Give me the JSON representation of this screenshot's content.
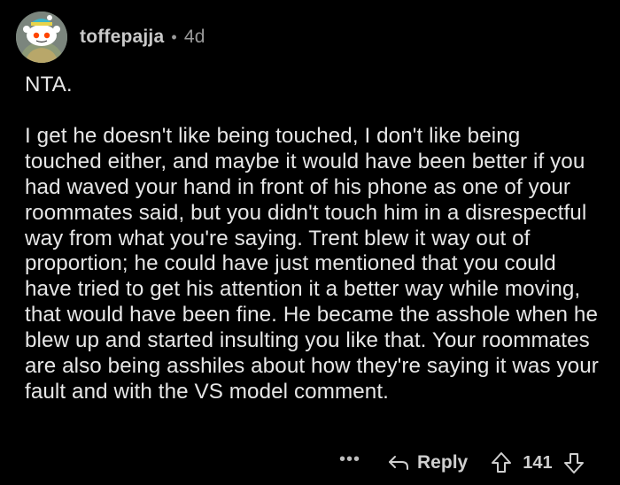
{
  "comment": {
    "author": "toffepajja",
    "separator": "•",
    "age": "4d",
    "paragraphs": [
      "NTA.",
      "I get he doesn't like being touched, I don't like being touched either, and maybe it would have been better if you had waved your hand in front of his phone as one of your roommates said, but you didn't touch him in a disrespectful way from what you're saying. Trent blew it way out of proportion; he could have just mentioned that you could have tried to get his attention it a better way while moving, that would have been fine. He became the asshole when he blew up and started insulting you like that. Your roommates are also being asshiles about how they're saying it was your fault and with the VS model comment."
    ]
  },
  "actions": {
    "more_label": "•••",
    "reply_label": "Reply",
    "vote_count": "141",
    "icons": {
      "more": "more-options-icon",
      "reply": "reply-arrow-icon",
      "upvote": "upvote-arrow-icon",
      "downvote": "downvote-arrow-icon"
    }
  },
  "colors": {
    "background": "#000000",
    "text": "#e6e6e6",
    "muted": "#9a9a9a"
  }
}
